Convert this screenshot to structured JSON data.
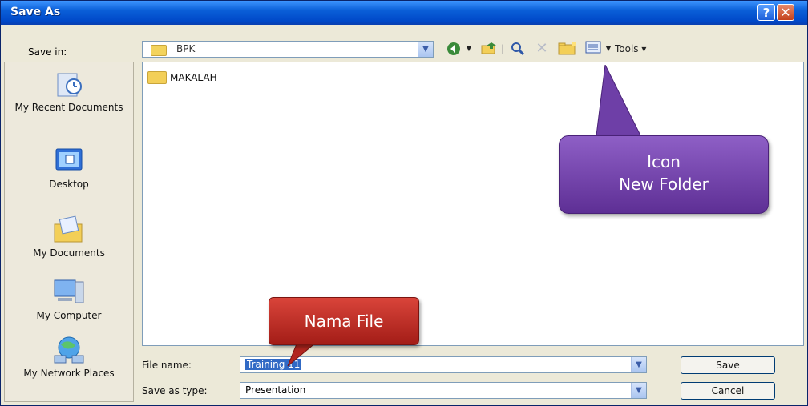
{
  "window": {
    "title": "Save As"
  },
  "toolbar": {
    "save_in_label": "Save in:",
    "path": "BPK",
    "tools_label": "Tools"
  },
  "places": [
    {
      "label": "My Recent Documents",
      "icon": "recent-documents-icon"
    },
    {
      "label": "Desktop",
      "icon": "desktop-icon"
    },
    {
      "label": "My Documents",
      "icon": "my-documents-icon"
    },
    {
      "label": "My Computer",
      "icon": "my-computer-icon"
    },
    {
      "label": "My Network Places",
      "icon": "network-places-icon"
    }
  ],
  "files": [
    {
      "name": "MAKALAH",
      "icon": "folder-icon"
    }
  ],
  "form": {
    "file_name_label": "File name:",
    "file_name_value": "Training 11",
    "save_as_type_label": "Save as type:",
    "save_as_type_value": "Presentation"
  },
  "buttons": {
    "save": "Save",
    "cancel": "Cancel"
  },
  "annotations": {
    "new_folder_line1": "Icon",
    "new_folder_line2": "New Folder",
    "file_name": "Nama File"
  },
  "colors": {
    "titlebar": "#0a5fd8",
    "callout_purple": "#7a47b3",
    "callout_red": "#c0302a"
  }
}
